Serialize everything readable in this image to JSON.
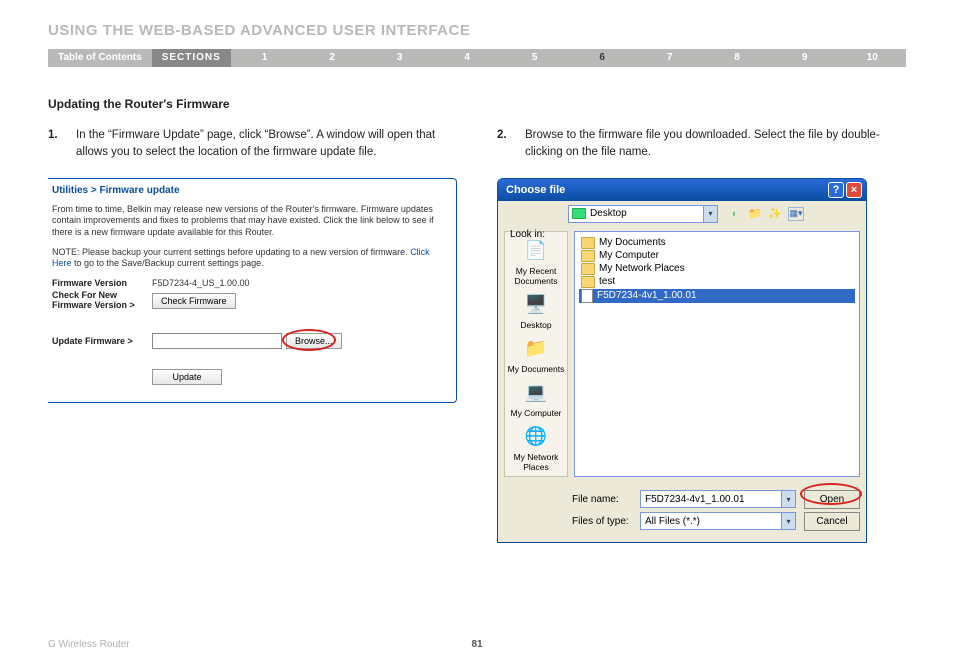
{
  "page_title": "USING THE WEB-BASED ADVANCED USER INTERFACE",
  "nav": {
    "toc": "Table of Contents",
    "sections_label": "SECTIONS",
    "items": [
      "1",
      "2",
      "3",
      "4",
      "5",
      "6",
      "7",
      "8",
      "9",
      "10"
    ],
    "active_index": 5
  },
  "subheading": "Updating the Router's Firmware",
  "steps": {
    "s1_num": "1.",
    "s1_text": "In the “Firmware Update” page, click “Browse”. A window will open that allows you to select the location of the firmware update file.",
    "s2_num": "2.",
    "s2_text": "Browse to the firmware file you downloaded. Select the file by double-clicking on the file name."
  },
  "firmware_panel": {
    "breadcrumb": "Utilities > Firmware update",
    "para1": "From time to time, Belkin may release new versions of the Router's firmware. Firmware updates contain improvements and fixes to problems that may have existed. Click the link below to see if there is a new firmware update available for this Router.",
    "note_prefix": "NOTE: Please backup your current settings before updating to a new version of firmware. ",
    "note_link": "Click Here",
    "note_suffix": " to go to the Save/Backup current settings page.",
    "row_fw_label": "Firmware Version",
    "row_fw_value": "F5D7234-4_US_1.00.00",
    "row_check_label": "Check For New Firmware Version >",
    "btn_check": "Check Firmware",
    "row_update_label": "Update Firmware >",
    "btn_browse": "Browse...",
    "btn_update": "Update"
  },
  "dialog": {
    "title": "Choose file",
    "lookin_label": "Look in:",
    "lookin_value": "Desktop",
    "toolbar_icons": [
      "back-icon",
      "up-icon",
      "new-folder-icon",
      "view-menu-icon"
    ],
    "places": [
      {
        "label": "My Recent Documents"
      },
      {
        "label": "Desktop"
      },
      {
        "label": "My Documents"
      },
      {
        "label": "My Computer"
      },
      {
        "label": "My Network Places"
      }
    ],
    "files": [
      {
        "name": "My Documents",
        "type": "folder"
      },
      {
        "name": "My Computer",
        "type": "folder"
      },
      {
        "name": "My Network Places",
        "type": "folder"
      },
      {
        "name": "test",
        "type": "folder"
      },
      {
        "name": "F5D7234-4v1_1.00.01",
        "type": "file",
        "selected": true
      }
    ],
    "filename_label": "File name:",
    "filename_value": "F5D7234-4v1_1.00.01",
    "filetype_label": "Files of type:",
    "filetype_value": "All Files (*.*)",
    "btn_open": "Open",
    "btn_cancel": "Cancel"
  },
  "footer": {
    "brand": "G Wireless Router",
    "page_number": "81"
  }
}
